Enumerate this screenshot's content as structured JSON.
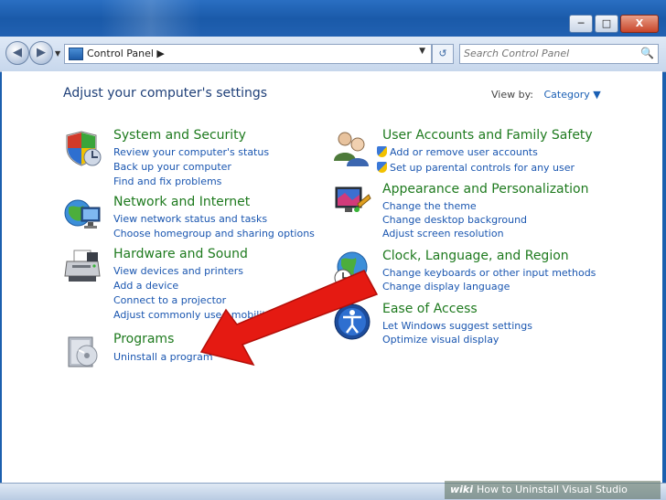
{
  "window": {
    "minimize_label": "─",
    "maximize_label": "□",
    "close_label": "X"
  },
  "nav": {
    "back": "◀",
    "forward": "▶",
    "dropdown": "▼",
    "refresh": "↺"
  },
  "address": {
    "crumb": "Control Panel  ▶",
    "dropdown": "▼"
  },
  "search": {
    "placeholder": "Search Control Panel",
    "icon": "🔍"
  },
  "header": {
    "title": "Adjust your computer's settings",
    "view_by_label": "View by:",
    "view_by_value": "Category ▼"
  },
  "categories": [
    {
      "title": "System and Security",
      "icon": "shield-icon",
      "links": [
        "Review your computer's status",
        "Back up your computer",
        "Find and fix problems"
      ]
    },
    {
      "title": "Network and Internet",
      "icon": "globe-network-icon",
      "links": [
        "View network status and tasks",
        "Choose homegroup and sharing options"
      ]
    },
    {
      "title": "Hardware and Sound",
      "icon": "printer-icon",
      "links": [
        "View devices and printers",
        "Add a device",
        "Connect to a projector",
        "Adjust commonly used mobility settings"
      ]
    },
    {
      "title": "Programs",
      "icon": "programs-icon",
      "links": [
        "Uninstall a program"
      ]
    },
    {
      "title": "User Accounts and Family Safety",
      "icon": "users-icon",
      "links": [
        "Add or remove user accounts",
        "Set up parental controls for any user"
      ]
    },
    {
      "title": "Appearance and Personalization",
      "icon": "display-icon",
      "links": [
        "Change the theme",
        "Change desktop background",
        "Adjust screen resolution"
      ]
    },
    {
      "title": "Clock, Language, and Region",
      "icon": "clock-globe-icon",
      "links": [
        "Change keyboards or other input methods",
        "Change display language"
      ]
    },
    {
      "title": "Ease of Access",
      "icon": "ease-of-access-icon",
      "links": [
        "Let Windows suggest settings",
        "Optimize visual display"
      ]
    }
  ],
  "watermark": {
    "brand": "wiki",
    "text": "How to Uninstall Visual Studio"
  }
}
